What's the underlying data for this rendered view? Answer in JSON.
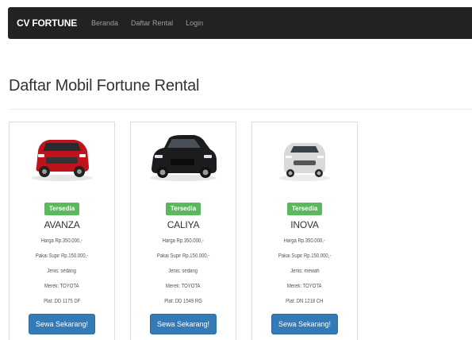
{
  "navbar": {
    "brand": "CV FORTUNE",
    "links": [
      "Beranda",
      "Daftar Rental",
      "Login"
    ]
  },
  "page": {
    "title": "Daftar Mobil Fortune Rental"
  },
  "cars": [
    {
      "status": "Tersedia",
      "name": "AVANZA",
      "harga": "Harga Rp.350.000,-",
      "supir": "Pakai Supir Rp.150.000,-",
      "jenis": "Jenis: sedang",
      "merek": "Merek: TOYOTA",
      "plat": "Plat: DD 1175 DF",
      "button": "Sewa Sekarang!",
      "color": "#c0121c"
    },
    {
      "status": "Tersedia",
      "name": "CALIYA",
      "harga": "Harga Rp.350.000,-",
      "supir": "Pakai Supir Rp.150.000,-",
      "jenis": "Jenis: sedang",
      "merek": "Merek: TOYOTA",
      "plat": "Plat: DD 1549 RG",
      "button": "Sewa Sekarang!",
      "color": "#1c1c1f"
    },
    {
      "status": "Tersedia",
      "name": "INOVA",
      "harga": "Harga Rp.350.000,-",
      "supir": "Pakai Supir Rp.150.000,-",
      "jenis": "Jenis: mewah",
      "merek": "Merek: TOYOTA",
      "plat": "Plat: DN 1218 CH",
      "button": "Sewa Sekarang!",
      "color": "#d8d9db"
    }
  ]
}
